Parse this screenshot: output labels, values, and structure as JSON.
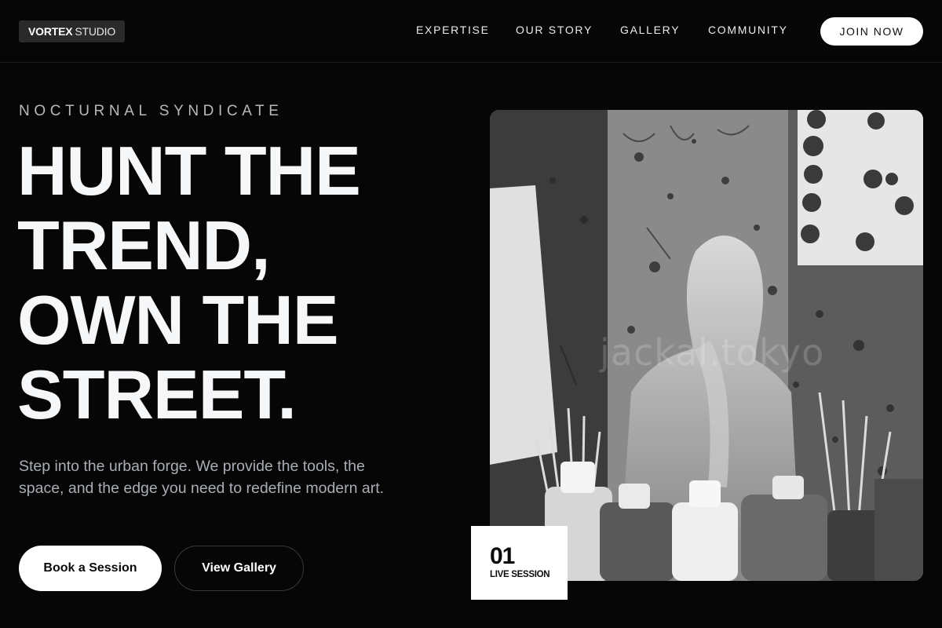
{
  "brand": {
    "name_bold": "VORTEX",
    "name_light": "STUDIO"
  },
  "nav": {
    "links": [
      {
        "label": "EXPERTISE"
      },
      {
        "label": "OUR STORY"
      },
      {
        "label": "GALLERY"
      },
      {
        "label": "COMMUNITY"
      }
    ],
    "cta_label": "JOIN NOW"
  },
  "hero": {
    "eyebrow": "NOCTURNAL SYNDICATE",
    "headline_lines": [
      "HUNT THE",
      "TREND,",
      "OWN THE",
      "STREET"
    ],
    "headline_end_mark": ".",
    "subtext": "Step into the urban forge. We provide the tools, the space, and the edge you need to redefine modern art.",
    "primary_button": "Book a Session",
    "secondary_button": "View Gallery",
    "image": {
      "description_icon": "photo-artist-studio-icon",
      "watermark": "jackal.tokyo"
    },
    "badge": {
      "number": "01",
      "label": "LIVE SESSION"
    }
  },
  "colors": {
    "background": "#060606",
    "text": "#f6f7f9",
    "muted": "#a9aeb5",
    "button_light": "#ffffff"
  }
}
